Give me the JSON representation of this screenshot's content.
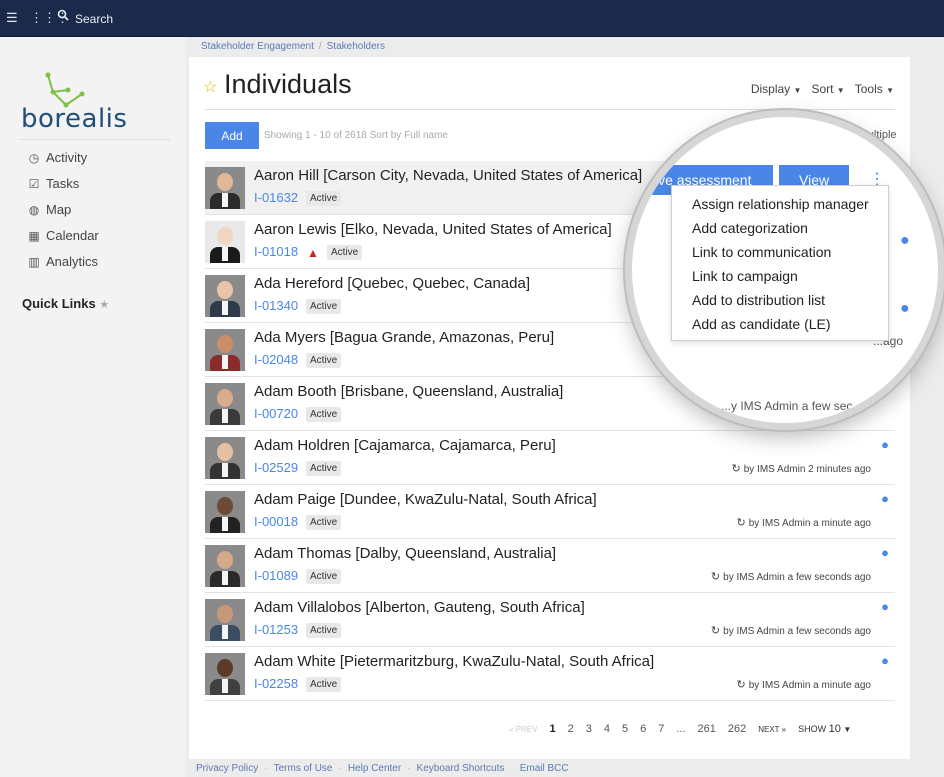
{
  "topbar": {
    "search_label": "Search"
  },
  "sidebar": {
    "logo_text": "borealis",
    "nav": [
      {
        "label": "Activity",
        "icon": "clock-icon"
      },
      {
        "label": "Tasks",
        "icon": "checkbox-icon"
      },
      {
        "label": "Map",
        "icon": "globe-icon"
      },
      {
        "label": "Calendar",
        "icon": "calendar-icon"
      },
      {
        "label": "Analytics",
        "icon": "bar-chart-icon"
      }
    ],
    "quick_links": "Quick Links"
  },
  "breadcrumb": [
    "Stakeholder Engagement",
    "Stakeholders"
  ],
  "page": {
    "title": "Individuals",
    "toolbar": {
      "display": "Display",
      "sort": "Sort",
      "tools": "Tools"
    },
    "add_label": "Add",
    "showing_text": "Showing 1 - 10 of 2618  Sort by  Full name",
    "select_multiple": "Select multiple"
  },
  "rows": [
    {
      "name": "Aaron Hill [Carson City, Nevada, United States of America]",
      "id": "I-01632",
      "status": "Active",
      "updated": "",
      "warning": false
    },
    {
      "name": "Aaron Lewis [Elko, Nevada, United States of America]",
      "id": "I-01018",
      "status": "Active",
      "updated": "",
      "warning": true
    },
    {
      "name": "Ada Hereford [Quebec, Quebec, Canada]",
      "id": "I-01340",
      "status": "Active",
      "updated": "",
      "warning": false
    },
    {
      "name": "Ada Myers [Bagua Grande, Amazonas, Peru]",
      "id": "I-02048",
      "status": "Active",
      "updated": "",
      "warning": false
    },
    {
      "name": "Adam Booth [Brisbane, Queensland, Australia]",
      "id": "I-00720",
      "status": "Active",
      "updated": "",
      "warning": false
    },
    {
      "name": "Adam Holdren [Cajamarca, Cajamarca, Peru]",
      "id": "I-02529",
      "status": "Active",
      "updated": "by IMS Admin 2 minutes ago",
      "warning": false
    },
    {
      "name": "Adam Paige [Dundee, KwaZulu-Natal, South Africa]",
      "id": "I-00018",
      "status": "Active",
      "updated": "by IMS Admin a minute ago",
      "warning": false
    },
    {
      "name": "Adam Thomas [Dalby, Queensland, Australia]",
      "id": "I-01089",
      "status": "Active",
      "updated": "by IMS Admin a few seconds ago",
      "warning": false
    },
    {
      "name": "Adam Villalobos [Alberton, Gauteng, South Africa]",
      "id": "I-01253",
      "status": "Active",
      "updated": "by IMS Admin a few seconds ago",
      "warning": false
    },
    {
      "name": "Adam White [Pietermaritzburg, KwaZulu-Natal, South Africa]",
      "id": "I-02258",
      "status": "Active",
      "updated": "by IMS Admin a minute ago",
      "warning": false
    }
  ],
  "pagination": {
    "prev": "« PREV",
    "pages": [
      "1",
      "2",
      "3",
      "4",
      "5",
      "6",
      "7",
      "...",
      "261",
      "262"
    ],
    "current": "1",
    "next": "NEXT »",
    "show_label": "SHOW",
    "show_value": "10"
  },
  "footer": [
    "Privacy Policy",
    "Terms of Use",
    "Help Center",
    "Keyboard Shortcuts",
    "Email BCC"
  ],
  "magnifier": {
    "assess_button": "ive assessment",
    "view_button": "View",
    "menu": [
      "Assign relationship manager",
      "Add categorization",
      "Link to communication",
      "Link to campaign",
      "Add to distribution list",
      "Add as candidate (LE)"
    ],
    "behind_text_1": "...y IMS Admin a few sec",
    "behind_text_2": "...s ago",
    "behind_text_3": "...ago"
  },
  "colors": {
    "accent": "#4a86e8",
    "topbar": "#1b2a4a",
    "brand": "#1f4e79",
    "logo_green": "#7cc143"
  }
}
